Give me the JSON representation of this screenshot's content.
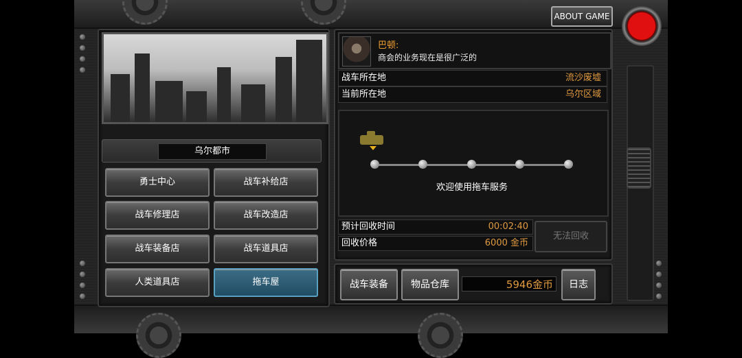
{
  "header": {
    "about_label": "ABOUT GAME"
  },
  "city": {
    "name": "乌尔都市"
  },
  "menu": {
    "buttons": [
      "勇士中心",
      "战车补给店",
      "战车修理店",
      "战车改造店",
      "战车装备店",
      "战车道具店",
      "人类道具店",
      "拖车屋"
    ],
    "active": "拖车屋"
  },
  "dialog": {
    "speaker": "巴顿:",
    "text": "商会的业务现在是很广泛的"
  },
  "location": {
    "tank_label": "战车所在地",
    "tank_value": "流沙废墟",
    "current_label": "当前所在地",
    "current_value": "乌尔区域"
  },
  "tow": {
    "message": "欢迎使用拖车服务"
  },
  "recovery": {
    "time_label": "预计回收时间",
    "time_value": "00:02:40",
    "price_label": "回收价格",
    "price_value": "6000 金币",
    "button_label": "无法回收"
  },
  "bottom": {
    "equip_label": "战车装备",
    "storage_label": "物品仓库",
    "gold": "5946金币",
    "log_label": "日志"
  },
  "colors": {
    "accent_gold": "#e09a40",
    "active_button": "#2a5a72",
    "record_red": "#e01010"
  }
}
